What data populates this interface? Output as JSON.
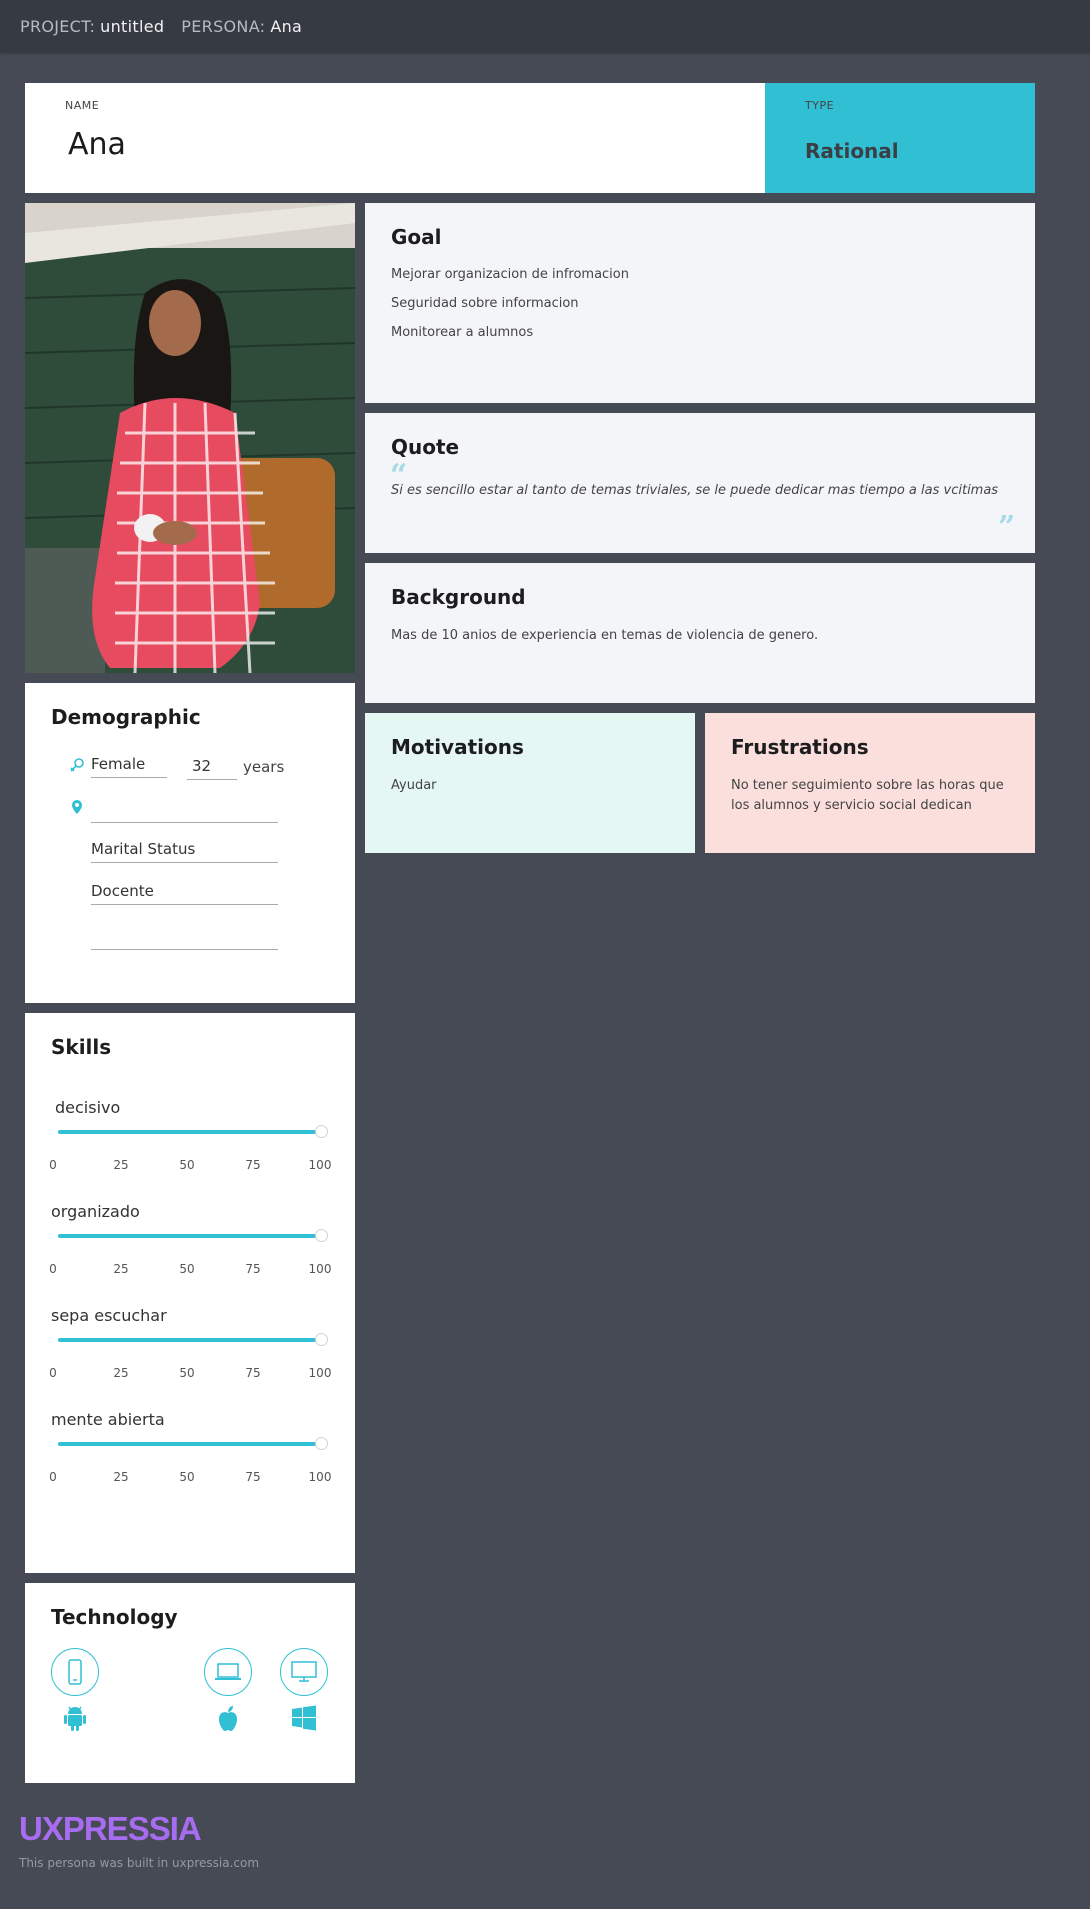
{
  "topbar": {
    "project_label": "PROJECT:",
    "project_value": "untitled",
    "persona_label": "PERSONA:",
    "persona_value": "Ana"
  },
  "name_card": {
    "label": "NAME",
    "value": "Ana"
  },
  "type_card": {
    "label": "TYPE",
    "value": "Rational"
  },
  "goal": {
    "title": "Goal",
    "items": [
      "Mejorar organizacion de infromacion",
      "Seguridad sobre informacion",
      "Monitorear a alumnos"
    ]
  },
  "quote": {
    "title": "Quote",
    "text": "Si es sencillo estar al tanto de temas triviales, se le puede dedicar mas tiempo a las vcitimas"
  },
  "background": {
    "title": "Background",
    "text": "Mas de 10 anios de experiencia en temas de violencia de genero."
  },
  "motivations": {
    "title": "Motivations",
    "text": "Ayudar"
  },
  "frustrations": {
    "title": "Frustrations",
    "text": "No tener seguimiento sobre las horas que los alumnos y servicio social dedican"
  },
  "demographic": {
    "title": "Demographic",
    "gender": "Female",
    "age": "32",
    "age_unit": "years",
    "location": "",
    "marital_status": "Marital Status",
    "occupation": "Docente",
    "extra": ""
  },
  "skills": {
    "title": "Skills",
    "scale_ticks": [
      "0",
      "25",
      "50",
      "75",
      "100"
    ],
    "items": [
      {
        "name": "decisivo",
        "value": 100
      },
      {
        "name": "organizado",
        "value": 100
      },
      {
        "name": "sepa escuchar",
        "value": 100
      },
      {
        "name": "mente abierta",
        "value": 100
      }
    ]
  },
  "technology": {
    "title": "Technology",
    "devices": [
      "mobile-icon",
      "laptop-icon",
      "desktop-icon"
    ],
    "platforms": [
      "android-icon",
      "apple-icon",
      "windows-icon"
    ]
  },
  "footer": {
    "brand": "UXPRESSIA",
    "note": "This persona was built in uxpressia.com"
  },
  "colors": {
    "accent": "#31bfd3",
    "motivations_bg": "#e4f7f3",
    "frustrations_bg": "#fbdfdc",
    "page_bg": "#454a54",
    "brand": "#a86cf0"
  }
}
